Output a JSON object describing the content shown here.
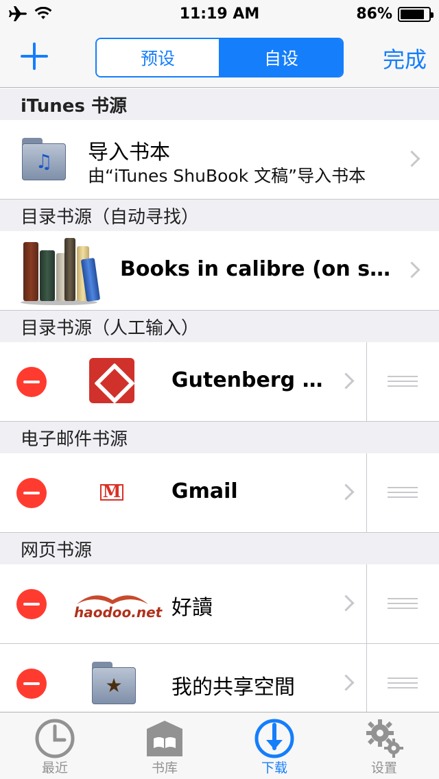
{
  "status_bar": {
    "time": "11:19 AM",
    "battery_percent": "86%",
    "battery_level": 0.86,
    "icons": [
      "airplane-icon",
      "wifi-icon",
      "battery-icon"
    ]
  },
  "nav": {
    "add_icon": "plus-icon",
    "segments": [
      "预设",
      "自设"
    ],
    "selected_segment": "自设",
    "done_label": "完成"
  },
  "sections": {
    "itunes": "iTunes 书源",
    "catalog_auto": "目录书源（自动寻找）",
    "catalog_manual": "目录书源（人工输入）",
    "email": "电子邮件书源",
    "web": "网页书源"
  },
  "rows": {
    "import": {
      "title": "导入书本",
      "subtitle": "由“iTunes ShuBook 文稿”导入书本",
      "icon": "itunes-folder-icon"
    },
    "calibre": {
      "title": "Books in calibre (on server)",
      "icon": "books-icon"
    },
    "gutenberg": {
      "title": "Gutenberg Project",
      "icon": "gutenberg-icon"
    },
    "gmail": {
      "title": "Gmail",
      "icon": "gmail-icon"
    },
    "haodoo": {
      "title": "好讀",
      "logo_text": "haodoo.net",
      "icon": "haodoo-logo"
    },
    "shared": {
      "title": "我的共享空間",
      "icon": "star-folder-icon"
    }
  },
  "tabs": [
    {
      "label": "最近",
      "icon": "clock-icon"
    },
    {
      "label": "书库",
      "icon": "book-icon"
    },
    {
      "label": "下载",
      "icon": "download-icon",
      "active": true
    },
    {
      "label": "设置",
      "icon": "gear-icon"
    }
  ],
  "colors": {
    "accent": "#157efb",
    "delete": "#ff3b30",
    "section_bg": "#efeff4"
  }
}
